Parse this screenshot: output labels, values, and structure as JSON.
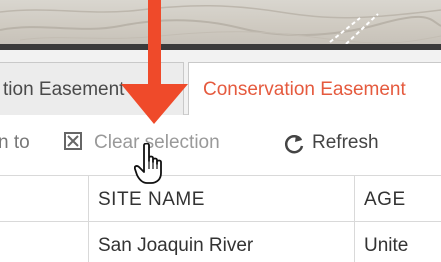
{
  "tabs": [
    {
      "label": "tion Easement"
    },
    {
      "label": "Conservation Easement"
    }
  ],
  "toolbar": {
    "zoom_label": "n to",
    "clear_label": "Clear selection",
    "refresh_label": "Refresh"
  },
  "table": {
    "columns": [
      "SITE NAME",
      "AGE"
    ],
    "rows": [
      [
        "San Joaquin River",
        "Unite"
      ]
    ]
  },
  "colors": {
    "accent": "#e55a3e",
    "arrow": "#ef4a2a"
  },
  "icons": {
    "clear": "checkbox-x-icon",
    "refresh": "refresh-icon",
    "cursor": "hand-pointer-icon",
    "arrow": "down-arrow-annotation"
  }
}
